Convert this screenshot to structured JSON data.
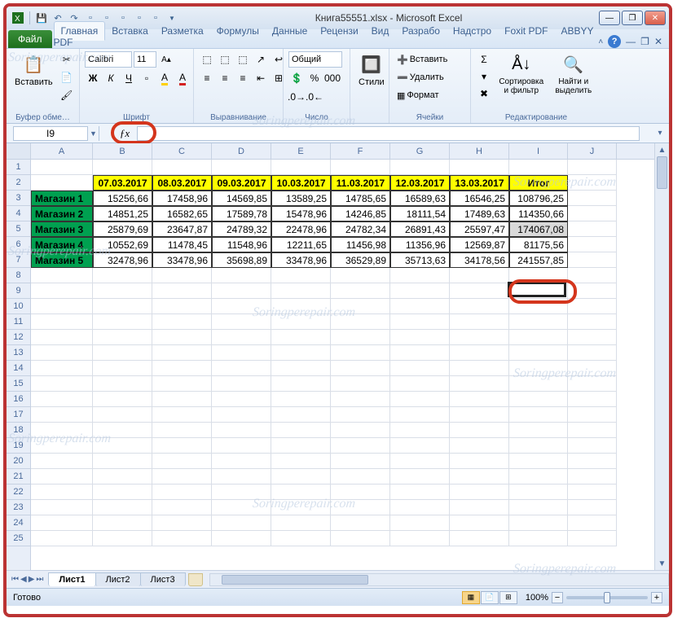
{
  "title": "Книга55551.xlsx - Microsoft Excel",
  "ribbon": {
    "file": "Файл",
    "tabs": [
      "Главная",
      "Вставка",
      "Разметка",
      "Формулы",
      "Данные",
      "Рецензи",
      "Вид",
      "Разрабо",
      "Надстро",
      "Foxit PDF",
      "ABBYY PDF"
    ],
    "active_tab": "Главная",
    "clipboard": {
      "paste": "Вставить",
      "label": "Буфер обме…"
    },
    "font": {
      "name": "Calibri",
      "size": "11",
      "bold": "Ж",
      "italic": "К",
      "underline": "Ч",
      "label": "Шрифт"
    },
    "alignment": {
      "label": "Выравнивание"
    },
    "number": {
      "format": "Общий",
      "label": "Число"
    },
    "styles": {
      "btn": "Стили"
    },
    "cells": {
      "insert": "Вставить",
      "delete": "Удалить",
      "format": "Формат",
      "label": "Ячейки"
    },
    "editing": {
      "sort": "Сортировка и фильтр",
      "find": "Найти и выделить",
      "label": "Редактирование"
    }
  },
  "namebox": "I9",
  "formula": "",
  "columns": [
    "A",
    "B",
    "C",
    "D",
    "E",
    "F",
    "G",
    "H",
    "I",
    "J"
  ],
  "row_count": 25,
  "yellow_headers": [
    "07.03.2017",
    "08.03.2017",
    "09.03.2017",
    "10.03.2017",
    "11.03.2017",
    "12.03.2017",
    "13.03.2017",
    "Итог"
  ],
  "data_rows": [
    {
      "name": "Магазин 1",
      "vals": [
        "15256,66",
        "17458,96",
        "14569,85",
        "13589,25",
        "14785,65",
        "16589,63",
        "16546,25",
        "108796,25"
      ],
      "grey": false
    },
    {
      "name": "Магазин 2",
      "vals": [
        "14851,25",
        "16582,65",
        "17589,78",
        "15478,96",
        "14246,85",
        "18111,54",
        "17489,63",
        "114350,66"
      ],
      "grey": false
    },
    {
      "name": "Магазин 3",
      "vals": [
        "25879,69",
        "23647,87",
        "24789,32",
        "22478,96",
        "24782,34",
        "26891,43",
        "25597,47",
        "174067,08"
      ],
      "grey": true
    },
    {
      "name": "Магазин 4",
      "vals": [
        "10552,69",
        "11478,45",
        "11548,96",
        "12211,65",
        "11456,98",
        "11356,96",
        "12569,87",
        "81175,56"
      ],
      "grey": false
    },
    {
      "name": "Магазин 5",
      "vals": [
        "32478,96",
        "33478,96",
        "35698,89",
        "33478,96",
        "36529,89",
        "35713,63",
        "34178,56",
        "241557,85"
      ],
      "grey": false
    }
  ],
  "sheets": [
    "Лист1",
    "Лист2",
    "Лист3"
  ],
  "active_sheet": 0,
  "status": "Готово",
  "zoom": "100%",
  "chart_data": {
    "type": "table",
    "title": "",
    "columns": [
      "",
      "07.03.2017",
      "08.03.2017",
      "09.03.2017",
      "10.03.2017",
      "11.03.2017",
      "12.03.2017",
      "13.03.2017",
      "Итог"
    ],
    "rows": [
      [
        "Магазин 1",
        15256.66,
        17458.96,
        14569.85,
        13589.25,
        14785.65,
        16589.63,
        16546.25,
        108796.25
      ],
      [
        "Магазин 2",
        14851.25,
        16582.65,
        17589.78,
        15478.96,
        14246.85,
        18111.54,
        17489.63,
        114350.66
      ],
      [
        "Магазин 3",
        25879.69,
        23647.87,
        24789.32,
        22478.96,
        24782.34,
        26891.43,
        25597.47,
        174067.08
      ],
      [
        "Магазин 4",
        10552.69,
        11478.45,
        11548.96,
        12211.65,
        11456.98,
        11356.96,
        12569.87,
        81175.56
      ],
      [
        "Магазин 5",
        32478.96,
        33478.96,
        35698.89,
        33478.96,
        36529.89,
        35713.63,
        34178.56,
        241557.85
      ]
    ]
  },
  "watermark_text": "Soringperepair.com"
}
